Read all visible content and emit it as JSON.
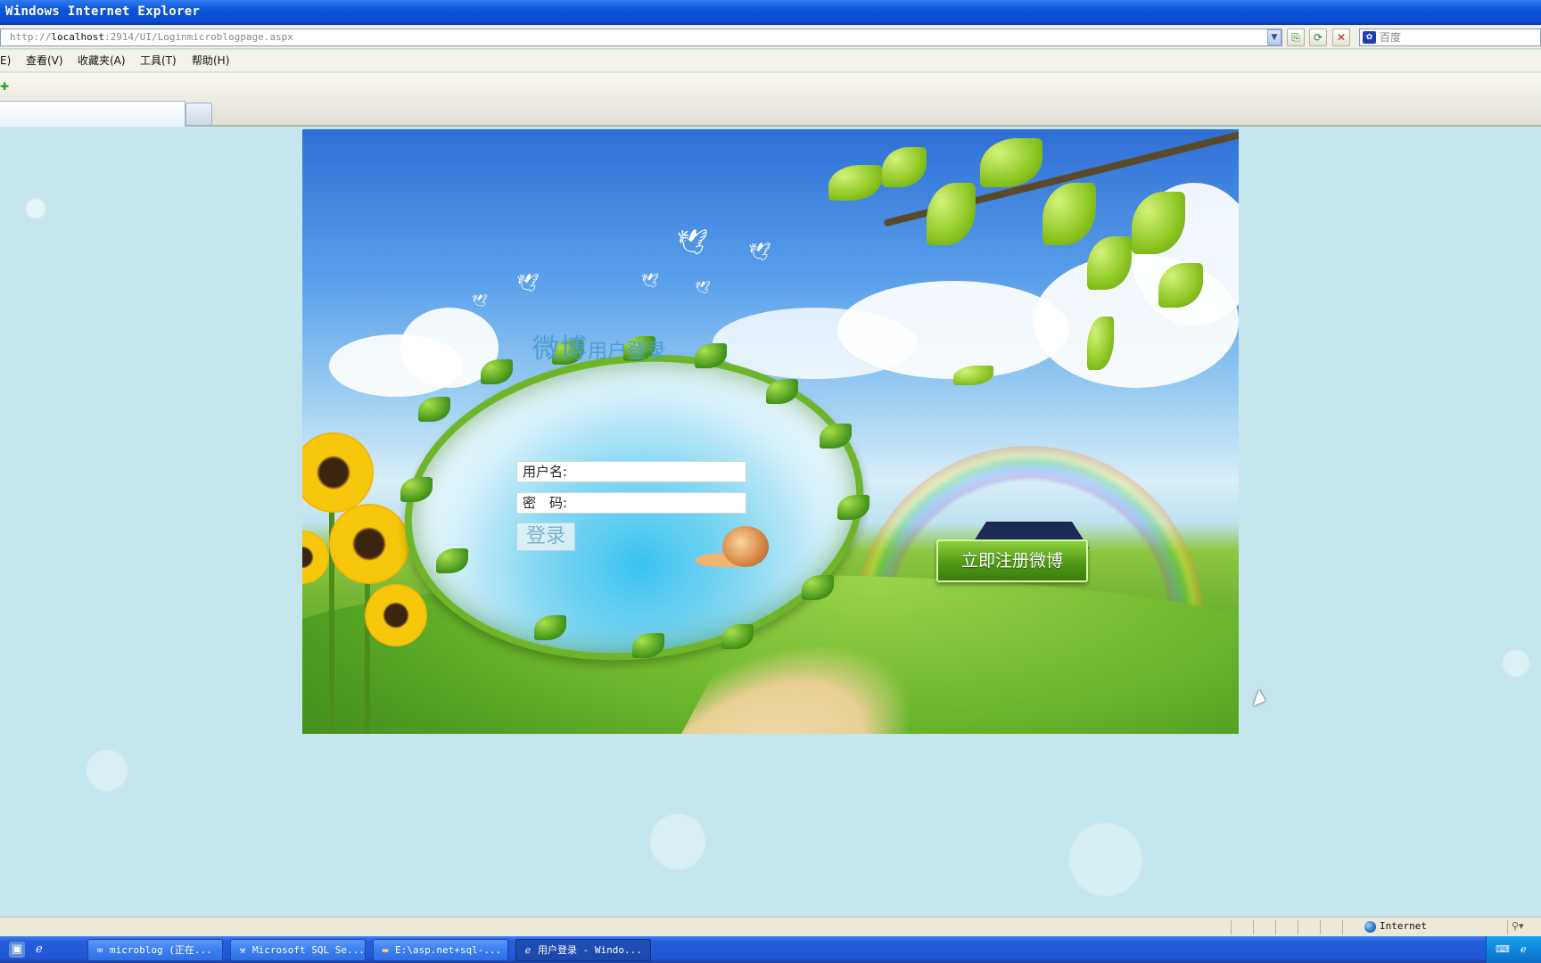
{
  "window": {
    "title": "Windows Internet Explorer"
  },
  "address_bar": {
    "url_prefix": "http://",
    "url_host": "localhost",
    "url_rest": ":2914/UI/Loginmicroblogpage.aspx",
    "search_text": "百度"
  },
  "menu": {
    "items": [
      {
        "label": "E)"
      },
      {
        "label": "查看(V)"
      },
      {
        "label": "收藏夹(A)"
      },
      {
        "label": "工具(T)"
      },
      {
        "label": "帮助(H)"
      }
    ]
  },
  "page": {
    "title_main": "微博",
    "title_sub": "用户登录",
    "username_label": "用户名:",
    "password_label": "密　码:",
    "login_button": "登录",
    "register_button": "立即注册微博"
  },
  "status_bar": {
    "zone": "Internet"
  },
  "taskbar": {
    "tasks": [
      {
        "label": "microblog (正在..."
      },
      {
        "label": "Microsoft SQL Se..."
      },
      {
        "label": "E:\\asp.net+sql-..."
      },
      {
        "label": "用户登录 - Windo..."
      }
    ]
  },
  "colors": {
    "titlebar": "#0b55d8",
    "page_background": "#c6e6ee",
    "register_button": "#4f9a16",
    "app_title": "#4c9ed6"
  },
  "icons": [
    "ie-icon",
    "refresh-icon",
    "compatibility-icon",
    "stop-icon",
    "baidu-icon",
    "internet-globe-icon"
  ]
}
